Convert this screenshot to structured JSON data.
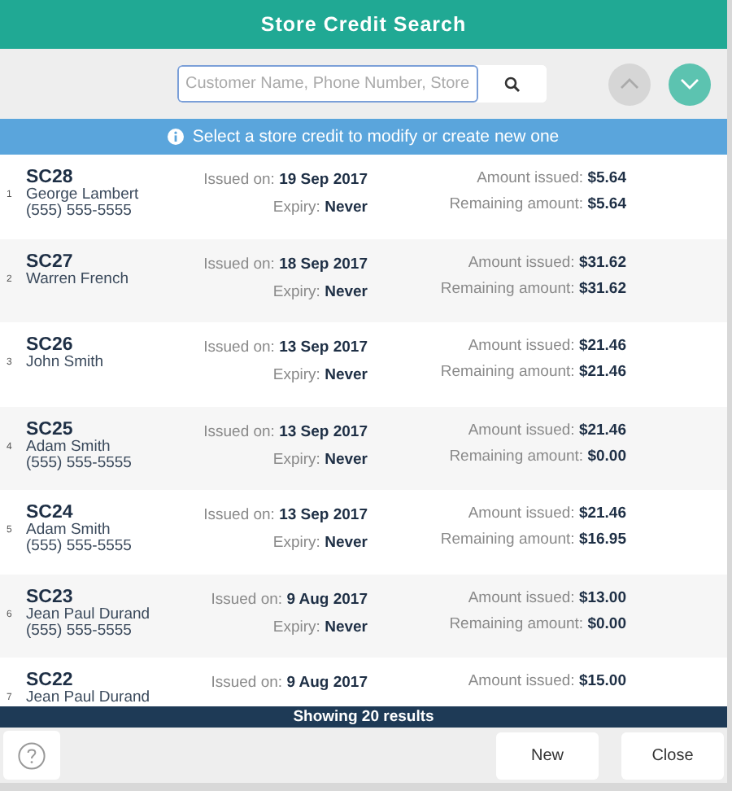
{
  "window": {
    "title": "Store Credit Search"
  },
  "search": {
    "placeholder": "Customer Name, Phone Number, Store"
  },
  "scroll_buttons": [
    {
      "kind": "up",
      "disabled": true
    },
    {
      "kind": "down",
      "disabled": false
    }
  ],
  "info_banner": "Select a store credit to modify or create new one",
  "credits": [
    {
      "index": "1",
      "code": "SC28",
      "customer": "George Lambert",
      "phone": "(555) 555-5555",
      "issued_label": "Issued on:",
      "issued": "19 Sep 2017",
      "expiry_label": "Expiry:",
      "expiry": "Never",
      "amount_label": "Amount issued:",
      "amount": "$5.64",
      "remaining_label": "Remaining amount:",
      "remaining": "$5.64"
    },
    {
      "index": "2",
      "code": "SC27",
      "customer": "Warren French",
      "issued_label": "Issued on:",
      "issued": "18 Sep 2017",
      "expiry_label": "Expiry:",
      "expiry": "Never",
      "amount_label": "Amount issued:",
      "amount": "$31.62",
      "remaining_label": "Remaining amount:",
      "remaining": "$31.62"
    },
    {
      "index": "3",
      "code": "SC26",
      "customer": "John Smith",
      "issued_label": "Issued on:",
      "issued": "13 Sep 2017",
      "expiry_label": "Expiry:",
      "expiry": "Never",
      "amount_label": "Amount issued:",
      "amount": "$21.46",
      "remaining_label": "Remaining amount:",
      "remaining": "$21.46"
    },
    {
      "index": "4",
      "code": "SC25",
      "customer": "Adam Smith",
      "phone": "(555) 555-5555",
      "issued_label": "Issued on:",
      "issued": "13 Sep 2017",
      "expiry_label": "Expiry:",
      "expiry": "Never",
      "amount_label": "Amount issued:",
      "amount": "$21.46",
      "remaining_label": "Remaining amount:",
      "remaining": "$0.00"
    },
    {
      "index": "5",
      "code": "SC24",
      "customer": "Adam Smith",
      "phone": "(555) 555-5555",
      "issued_label": "Issued on:",
      "issued": "13 Sep 2017",
      "expiry_label": "Expiry:",
      "expiry": "Never",
      "amount_label": "Amount issued:",
      "amount": "$21.46",
      "remaining_label": "Remaining amount:",
      "remaining": "$16.95"
    },
    {
      "index": "6",
      "code": "SC23",
      "customer": "Jean Paul Durand",
      "phone": "(555) 555-5555",
      "issued_label": "Issued on:",
      "issued": "9 Aug 2017",
      "expiry_label": "Expiry:",
      "expiry": "Never",
      "amount_label": "Amount issued:",
      "amount": "$13.00",
      "remaining_label": "Remaining amount:",
      "remaining": "$0.00"
    },
    {
      "index": "7",
      "code": "SC22",
      "customer": "Jean Paul Durand",
      "issued_label": "Issued on:",
      "issued": "9 Aug 2017",
      "amount_label": "Amount issued:",
      "amount": "$15.00"
    }
  ],
  "status_bar": "Showing 20 results",
  "buttons": [
    "New",
    "Close"
  ]
}
